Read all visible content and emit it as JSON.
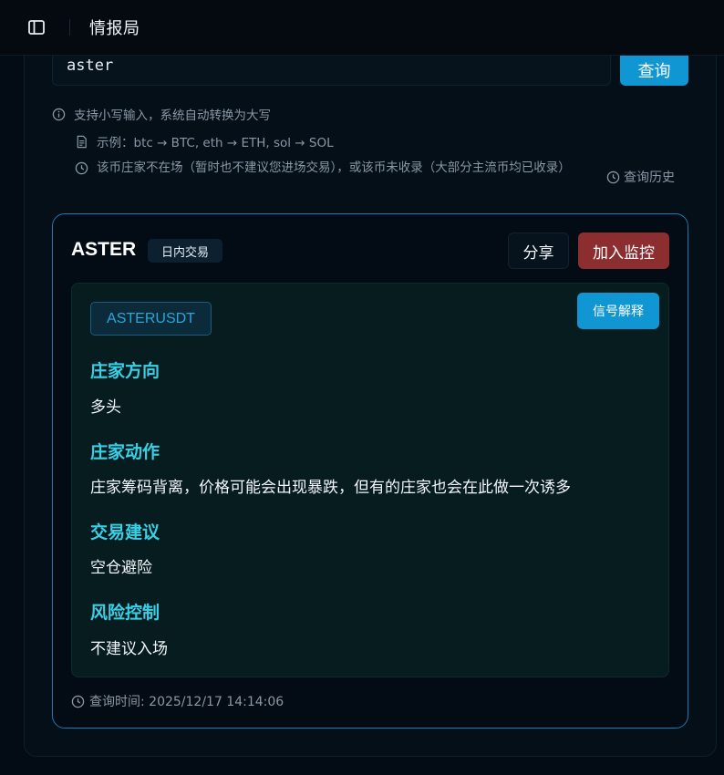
{
  "header": {
    "title": "情报局",
    "toggle_icon": "sidebar-toggle-icon"
  },
  "search": {
    "value": "aster",
    "button_label": "查询"
  },
  "hints": [
    {
      "icon": "info-icon",
      "text": "支持小写输入，系统自动转换为大写"
    },
    {
      "icon": "document-icon",
      "text": "示例：btc → BTC, eth → ETH, sol → SOL"
    },
    {
      "icon": "clock-icon",
      "text": "该币庄家不在场（暂时也不建议您进场交易），或该币未收录（大部分主流币均已收录）"
    }
  ],
  "history": {
    "icon": "clock-icon",
    "label": "查询历史"
  },
  "result": {
    "symbol": "ASTER",
    "mode": "日内交易",
    "share_label": "分享",
    "monitor_label": "加入监控",
    "pair": "ASTERUSDT",
    "explain_label": "信号解释",
    "sections": [
      {
        "title": "庄家方向",
        "value": "多头"
      },
      {
        "title": "庄家动作",
        "value": "庄家筹码背离，价格可能会出现暴跌，但有的庄家也会在此做一次诱多"
      },
      {
        "title": "交易建议",
        "value": "空仓避险"
      },
      {
        "title": "风险控制",
        "value": "不建议入场"
      }
    ],
    "query_time": "查询时间: 2025/12/17 14:14:06"
  },
  "colors": {
    "accent": "#1096d2",
    "danger": "#8c2d30",
    "section_title": "#38d0e6",
    "card_border": "#1f78b4"
  }
}
